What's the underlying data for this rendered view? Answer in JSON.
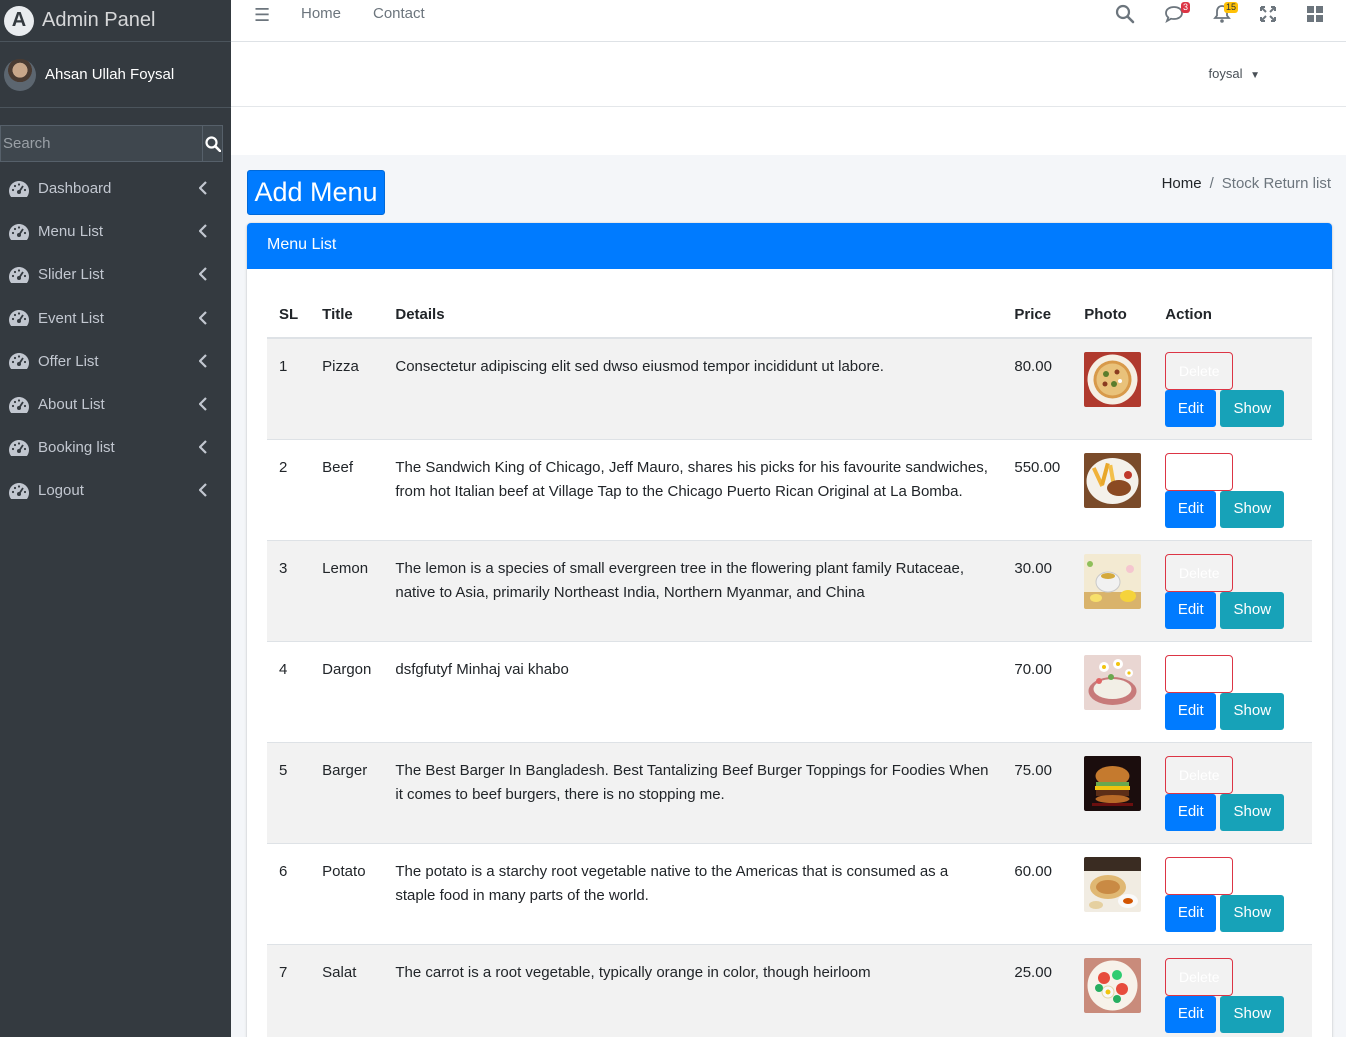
{
  "brand": {
    "title": "Admin Panel",
    "logo_letter": "A"
  },
  "user": {
    "name": "Ahsan Ullah Foysal"
  },
  "search": {
    "placeholder": "Search"
  },
  "sidebar": {
    "items": [
      {
        "label": "Dashboard",
        "icon": "tachometer-icon"
      },
      {
        "label": "Menu List",
        "icon": "tachometer-icon"
      },
      {
        "label": "Slider List",
        "icon": "tachometer-icon"
      },
      {
        "label": "Event List",
        "icon": "tachometer-icon"
      },
      {
        "label": "Offer List",
        "icon": "tachometer-icon"
      },
      {
        "label": "About List",
        "icon": "tachometer-icon"
      },
      {
        "label": "Booking list",
        "icon": "tachometer-icon"
      },
      {
        "label": "Logout",
        "icon": "tachometer-icon"
      }
    ]
  },
  "topnav": {
    "links": [
      "Home",
      "Contact"
    ],
    "messages_count": "3",
    "notifications_count": "15"
  },
  "user_dropdown": {
    "label": "foysal"
  },
  "page": {
    "add_button": "Add Menu",
    "breadcrumb": {
      "home": "Home",
      "current": "Stock Return list"
    },
    "card_title": "Menu List"
  },
  "table": {
    "headers": [
      "SL",
      "Title",
      "Details",
      "Price",
      "Photo",
      "Action"
    ],
    "rows": [
      {
        "sl": "1",
        "title": "Pizza",
        "details": "Consectetur adipiscing elit sed dwso eiusmod tempor incididunt ut labore.",
        "price": "80.00",
        "photo": "pizza"
      },
      {
        "sl": "2",
        "title": "Beef",
        "details": "The Sandwich King of Chicago, Jeff Mauro, shares his picks for his favourite sandwiches, from hot Italian beef at Village Tap to the Chicago Puerto Rican Original at La Bomba.",
        "price": "550.00",
        "photo": "beef"
      },
      {
        "sl": "3",
        "title": "Lemon",
        "details": "The lemon is a species of small evergreen tree in the flowering plant family Rutaceae, native to Asia, primarily Northeast India, Northern Myanmar, and China",
        "price": "30.00",
        "photo": "lemon"
      },
      {
        "sl": "4",
        "title": "Dargon",
        "details": "dsfgfutyf Minhaj vai khabo",
        "price": "70.00",
        "photo": "dargon"
      },
      {
        "sl": "5",
        "title": "Barger",
        "details": "The Best Barger In Bangladesh. Best Tantalizing Beef Burger Toppings for Foodies When it comes to beef burgers, there is no stopping me.",
        "price": "75.00",
        "photo": "burger"
      },
      {
        "sl": "6",
        "title": "Potato",
        "details": "The potato is a starchy root vegetable native to the Americas that is consumed as a staple food in many parts of the world.",
        "price": "60.00",
        "photo": "potato"
      },
      {
        "sl": "7",
        "title": "Salat",
        "details": "The carrot is a root vegetable, typically orange in color, though heirloom",
        "price": "25.00",
        "photo": "salad"
      }
    ],
    "buttons": {
      "delete": "Delete",
      "edit": "Edit",
      "show": "Show"
    }
  },
  "colors": {
    "primary": "#007bff",
    "info": "#17a2b8",
    "danger": "#dc3545",
    "sidebar": "#343a40"
  }
}
